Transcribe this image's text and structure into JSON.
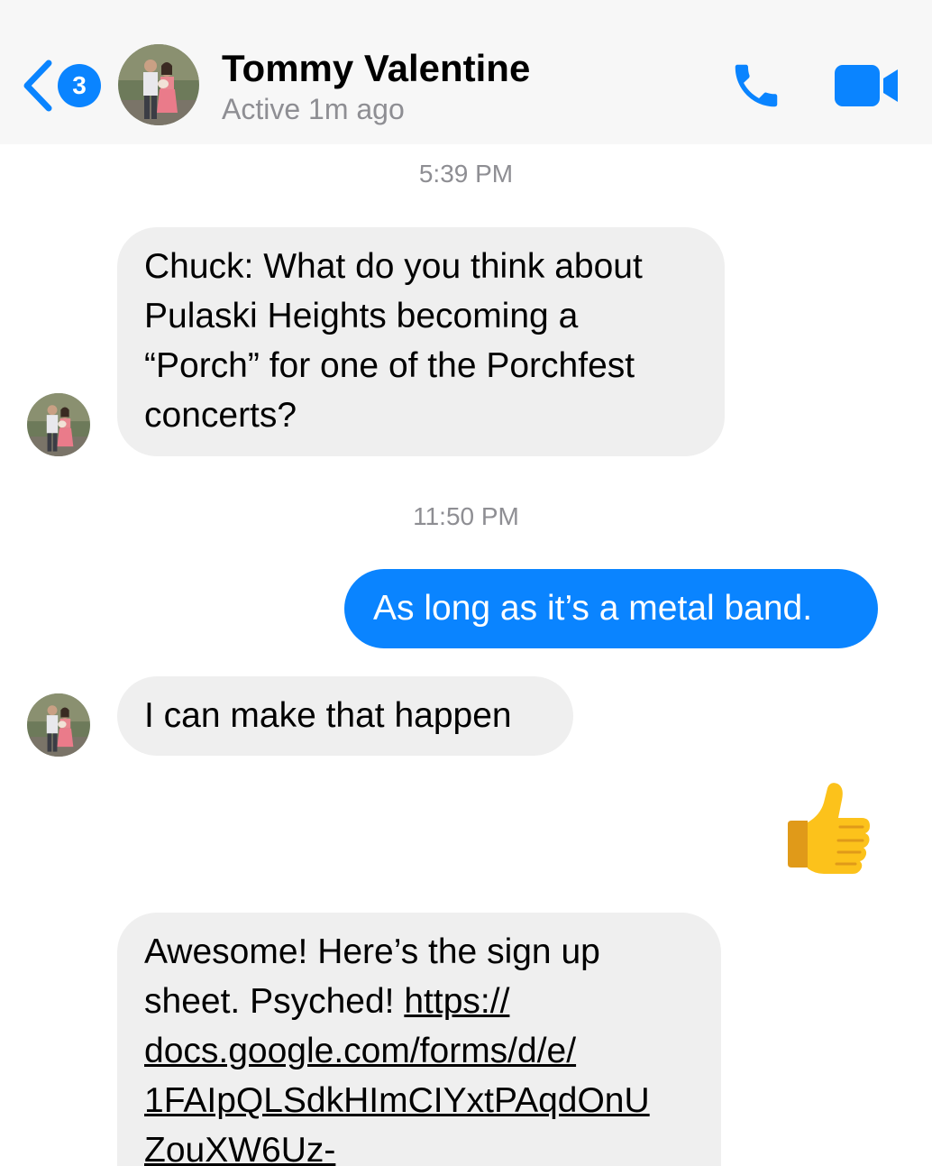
{
  "header": {
    "back_badge": "3",
    "contact_name": "Tommy Valentine",
    "contact_status": "Active 1m ago",
    "icons": {
      "back": "chevron-left-icon",
      "call": "phone-icon",
      "video": "video-camera-icon"
    }
  },
  "colors": {
    "accent": "#0a84ff",
    "incoming_bubble": "#efefef",
    "timestamp_text": "#8e8e93"
  },
  "messages": {
    "timestamp_1": "5:39 PM",
    "msg_1": {
      "line_1": "Chuck: What do you think about",
      "line_2": "Pulaski Heights becoming a",
      "line_3": "“Porch” for one of the Porchfest",
      "line_4": "concerts?"
    },
    "timestamp_2": "11:50 PM",
    "msg_2": "As long as it’s a metal band.",
    "msg_3": "I can make that happen",
    "msg_4_emoji": "👍",
    "msg_5": {
      "line_1": "Awesome! Here’s the sign up",
      "line_2_text": "sheet. Psyched! ",
      "line_2_link": "https://",
      "line_3_link": "docs.google.com/forms/d/e/",
      "line_4_link": "1FAIpQLSdkHImCIYxtPAqdOnU",
      "line_5_link": "ZouXW6Uz-"
    }
  }
}
